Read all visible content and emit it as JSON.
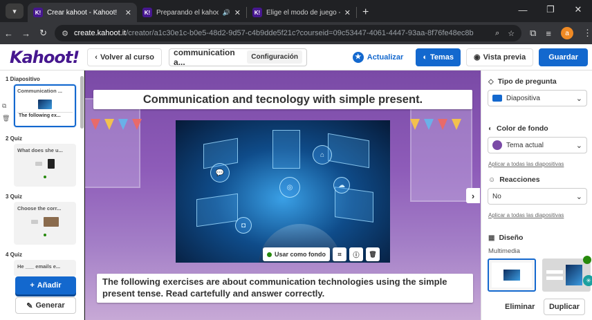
{
  "browser": {
    "tabs": [
      {
        "favicon": "K!",
        "title": "Crear kahoot - Kahoot!"
      },
      {
        "favicon": "K!",
        "title": "Preparando el kahoot - Kah"
      },
      {
        "favicon": "K!",
        "title": "Elige el modo de juego - Kahoo"
      }
    ],
    "url_host": "create.kahoot.it",
    "url_path": "/creator/a1c30e1c-b0e5-48d2-9d57-c4b9dde5f21c?courseid=09c53447-4061-4447-93aa-8f76fe48ec8b",
    "profile_initial": "a"
  },
  "header": {
    "logo": "Kahoot!",
    "back_label": "Volver al curso",
    "title": "communication a...",
    "settings_label": "Configuración",
    "update_label": "Actualizar",
    "themes_label": "Temas",
    "preview_label": "Vista previa",
    "save_label": "Guardar"
  },
  "slides_panel": {
    "items": [
      {
        "label": "1 Diapositivo",
        "title": "Communication ...",
        "caption": "The following ex..."
      },
      {
        "label": "2 Quiz",
        "title": "What does she u..."
      },
      {
        "label": "3 Quiz",
        "title": "Choose the corr..."
      },
      {
        "label": "4 Quiz",
        "title": "He ___ emails e..."
      }
    ],
    "add_label": "Añadir",
    "generate_label": "Generar"
  },
  "canvas": {
    "title": "Communication and tecnology with simple present.",
    "use_background_label": "Usar como fondo",
    "body": "The following exercises are about communication technologies using the simple present tense. Read cartefully and answer correctly."
  },
  "properties": {
    "question_type_heading": "Tipo de pregunta",
    "question_type_value": "Diapositiva",
    "bg_color_heading": "Color de fondo",
    "bg_color_value": "Tema actual",
    "apply_all_label": "Aplicar a todas las diapositivas",
    "reactions_heading": "Reacciones",
    "reactions_value": "No",
    "apply_all_label_2": "Aplicar a todas las diapositivas",
    "design_heading": "Diseño",
    "multimedia_label": "Multimedia",
    "delete_label": "Eliminar",
    "duplicate_label": "Duplicar"
  },
  "colors": {
    "brand": "#46178f",
    "accent_blue": "#1368ce",
    "canvas_purple": "#8e5cb9"
  }
}
